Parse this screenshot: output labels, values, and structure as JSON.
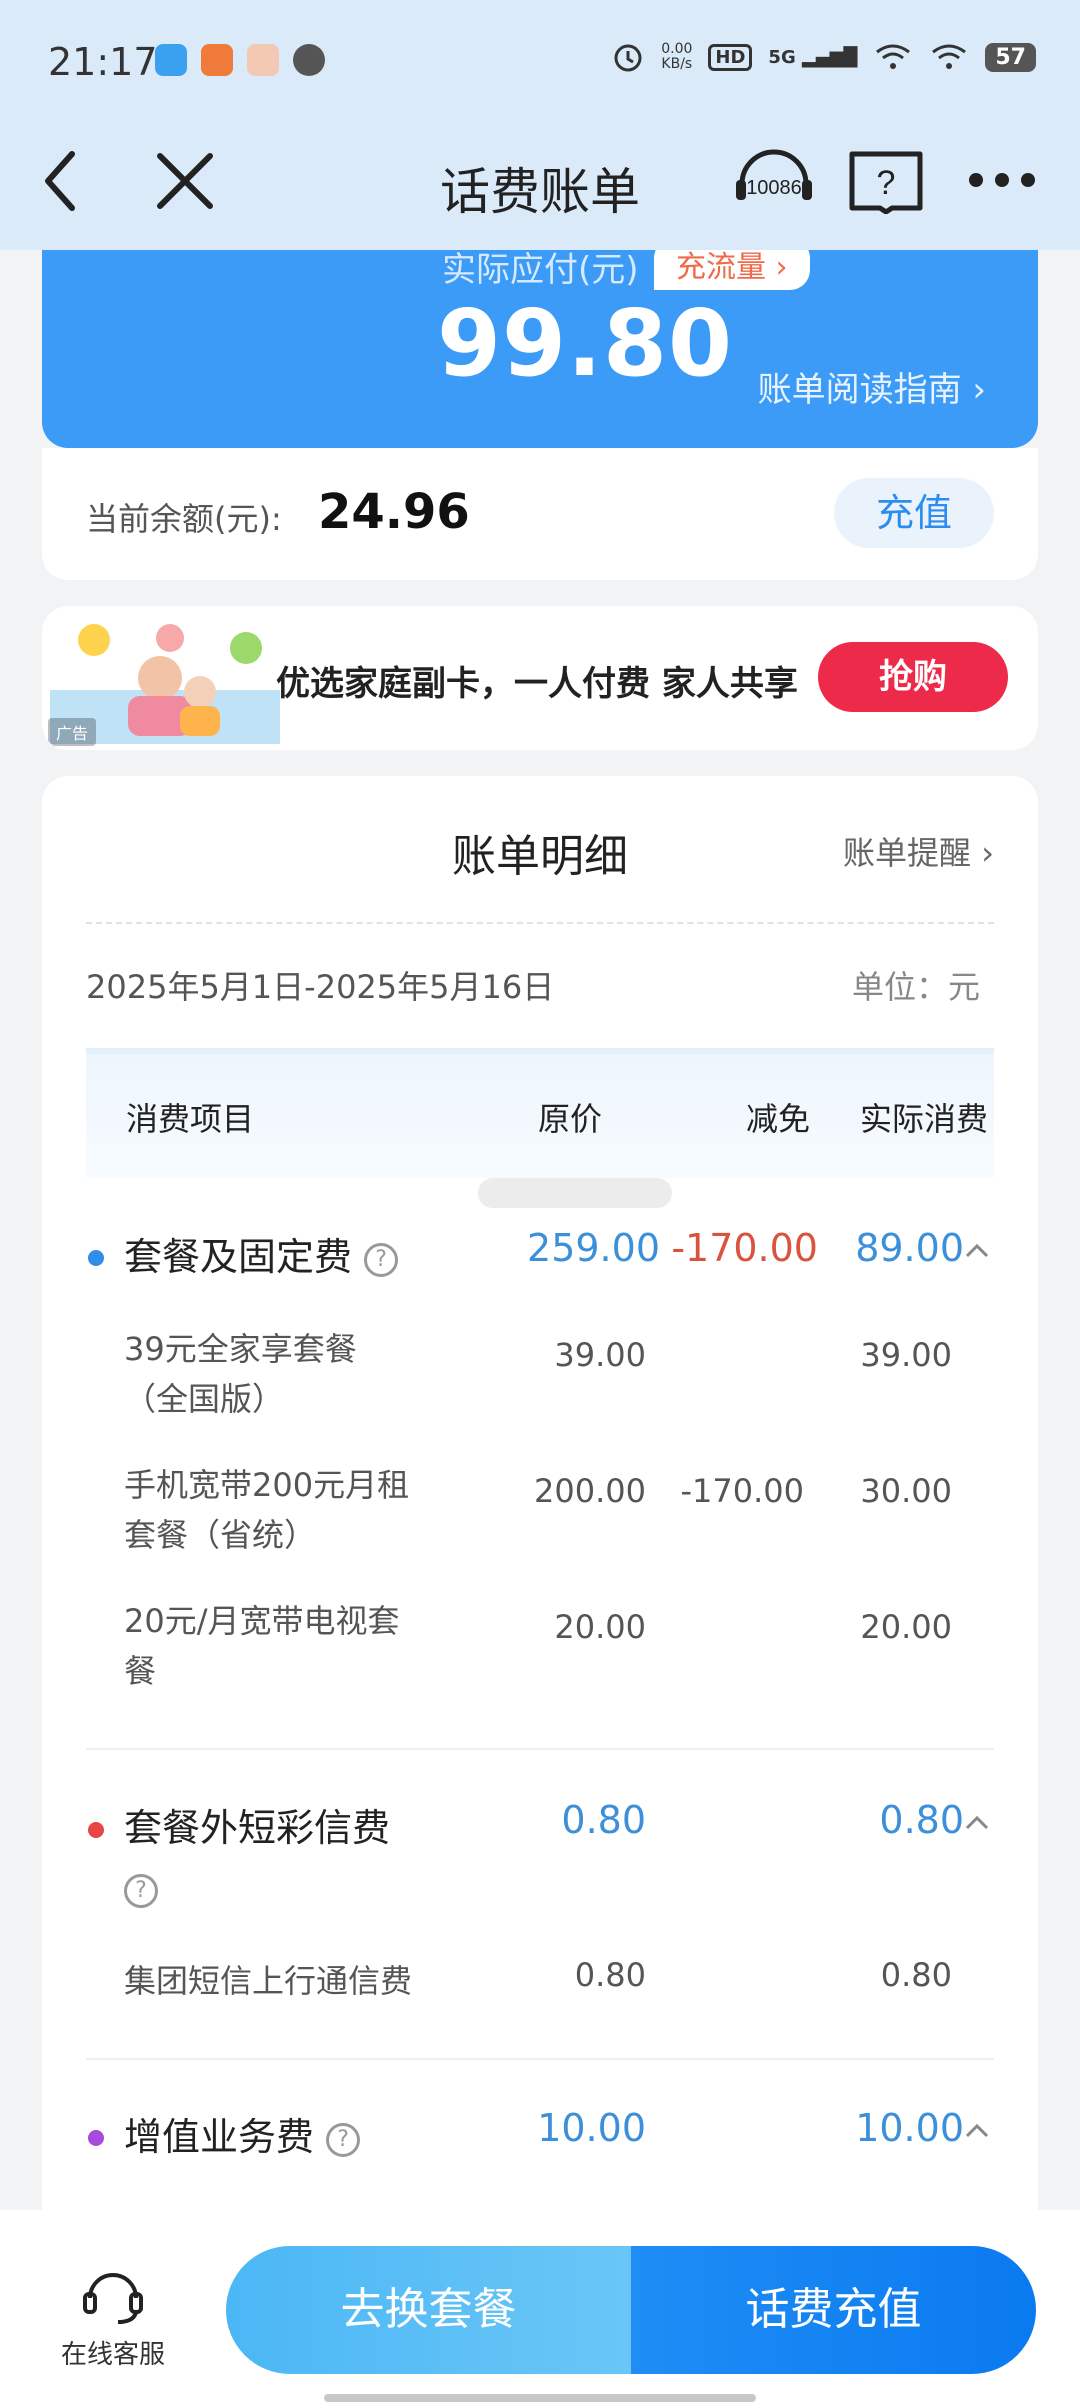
{
  "status_bar": {
    "time": "21:17",
    "net_speed_value": "0.00",
    "net_speed_unit": "KB/s",
    "hd": "HD",
    "signal": "5G",
    "battery": "57"
  },
  "nav": {
    "title": "话费账单",
    "hotline": "10086",
    "help_glyph": "?"
  },
  "summary": {
    "pay_label": "实际应付(元)",
    "traffic_button": "充流量 ›",
    "amount": "99.80",
    "guide_link": "账单阅读指南 ›",
    "balance_label": "当前余额(元):",
    "balance_value": "24.96",
    "recharge_button": "充值"
  },
  "ad": {
    "text": "优选家庭副卡，一人付费 家人共享",
    "button": "抢购",
    "tag": "广告"
  },
  "bill": {
    "title": "账单明细",
    "remind_link": "账单提醒 ›",
    "period": "2025年5月1日-2025年5月16日",
    "unit": "单位：元",
    "headers": {
      "item": "消费项目",
      "original": "原价",
      "discount": "减免",
      "actual": "实际消费"
    },
    "categories": [
      {
        "name": "套餐及固定费",
        "dot_color": "#2f8ee8",
        "original": "259.00",
        "discount": "-170.00",
        "actual": "89.00",
        "items": [
          {
            "line1": "39元全家享套餐",
            "line2": "（全国版）",
            "original": "39.00",
            "discount": "",
            "actual": "39.00"
          },
          {
            "line1": "手机宽带200元月租",
            "line2": "套餐（省统）",
            "original": "200.00",
            "discount": "-170.00",
            "actual": "30.00"
          },
          {
            "line1": "20元/月宽带电视套",
            "line2": "餐",
            "original": "20.00",
            "discount": "",
            "actual": "20.00"
          }
        ]
      },
      {
        "name": "套餐外短彩信费",
        "dot_color": "#e84545",
        "original": "0.80",
        "discount": "",
        "actual": "0.80",
        "items": [
          {
            "line1": "集团短信上行通信费",
            "line2": "",
            "original": "0.80",
            "discount": "",
            "actual": "0.80"
          }
        ]
      },
      {
        "name": "增值业务费",
        "dot_color": "#a74ae0",
        "original": "10.00",
        "discount": "",
        "actual": "10.00",
        "items": []
      }
    ]
  },
  "bottom": {
    "service_label": "在线客服",
    "change_plan": "去换套餐",
    "recharge": "话费充值"
  },
  "colors": {
    "primary_blue": "#3c9bf7",
    "value_blue": "#3c8fd8",
    "discount_red": "#d9533f",
    "buy_red": "#ee2a4a"
  }
}
